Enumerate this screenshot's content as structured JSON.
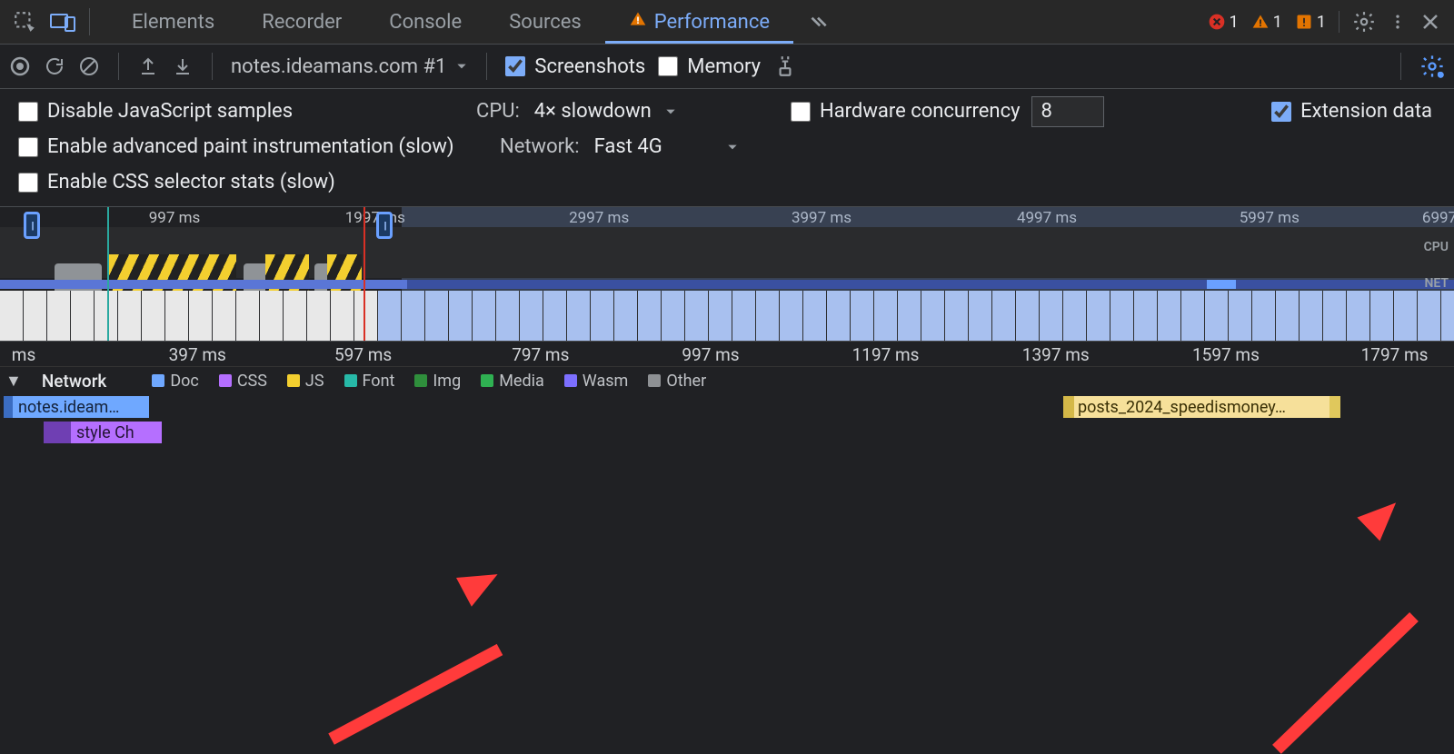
{
  "tabs": {
    "elements": "Elements",
    "recorder": "Recorder",
    "console": "Console",
    "sources": "Sources",
    "performance": "Performance"
  },
  "status_badges": {
    "error_count": "1",
    "warning_count": "1",
    "issue_count": "1"
  },
  "toolbar": {
    "recording_label": "notes.ideamans.com #1",
    "screenshots_label": "Screenshots",
    "memory_label": "Memory"
  },
  "settings": {
    "disable_js_label": "Disable JavaScript samples",
    "cpu_label": "CPU:",
    "cpu_value": "4× slowdown",
    "hw_label": "Hardware concurrency",
    "hw_value": "8",
    "extension_data_label": "Extension data",
    "paint_label": "Enable advanced paint instrumentation (slow)",
    "network_label": "Network:",
    "network_value": "Fast 4G",
    "css_stats_label": "Enable CSS selector stats (slow)"
  },
  "overview": {
    "ticks": [
      "997 ms",
      "1997 ms",
      "2997 ms",
      "3997 ms",
      "4997 ms",
      "5997 ms",
      "6997"
    ],
    "tick_positions_pct": [
      12.0,
      25.8,
      41.2,
      56.5,
      72.0,
      87.3,
      99.0
    ],
    "cpu_label": "CPU",
    "net_label": "NET"
  },
  "detail_ruler": {
    "labels": [
      "ms",
      "397 ms",
      "597 ms",
      "797 ms",
      "997 ms",
      "1197 ms",
      "1397 ms",
      "1597 ms",
      "1797 ms"
    ],
    "positions_pct": [
      0.8,
      11.6,
      23.0,
      35.2,
      46.9,
      58.6,
      70.3,
      82.0,
      93.6
    ]
  },
  "legend": {
    "doc": "Doc",
    "css": "CSS",
    "js": "JS",
    "font": "Font",
    "img": "Img",
    "media": "Media",
    "wasm": "Wasm",
    "other": "Other"
  },
  "network_track": {
    "title": "Network",
    "entry_doc": "notes.ideam…",
    "entry_css": "style Ch",
    "entry_js": "posts_2024_speedismoney…"
  },
  "colors": {
    "doc": "#6fa8ff",
    "css": "#b56fff",
    "js": "#f3cf2f",
    "font": "#27b9a8",
    "img": "#2f8f3c",
    "media": "#2fb152",
    "wasm": "#7c6fff",
    "other": "#8e9194"
  }
}
